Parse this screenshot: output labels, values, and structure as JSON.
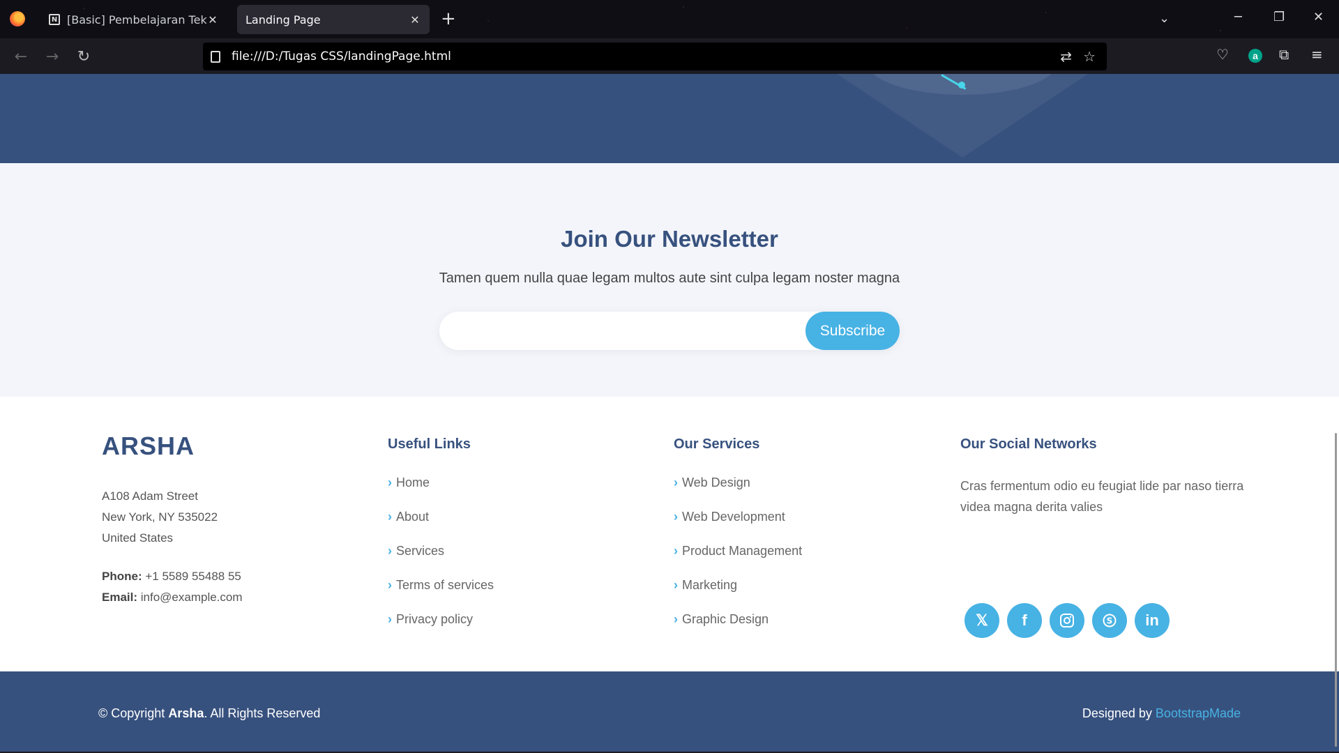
{
  "browser": {
    "tabs": [
      {
        "title": "[Basic] Pembelajaran Teknis Re",
        "favicon": "N"
      },
      {
        "title": "Landing Page"
      }
    ],
    "url": "file:///D:/Tugas CSS/landingPage.html",
    "account_initial": "a"
  },
  "newsletter": {
    "title": "Join Our Newsletter",
    "subtitle": "Tamen quem nulla quae legam multos aute sint culpa legam noster magna",
    "input_value": "",
    "button_label": "Subscribe"
  },
  "footer": {
    "brand": "ARSHA",
    "address": [
      "A108 Adam Street",
      "New York, NY 535022",
      "United States"
    ],
    "phone_label": "Phone:",
    "phone": " +1 5589 55488 55",
    "email_label": "Email:",
    "email": " info@example.com",
    "useful_links": {
      "title": "Useful Links",
      "items": [
        "Home",
        "About",
        "Services",
        "Terms of services",
        "Privacy policy"
      ]
    },
    "services": {
      "title": "Our Services",
      "items": [
        "Web Design",
        "Web Development",
        "Product Management",
        "Marketing",
        "Graphic Design"
      ]
    },
    "social": {
      "title": "Our Social Networks",
      "text": "Cras fermentum odio eu feugiat lide par naso tierra videa magna derita valies",
      "icons": [
        "x-icon",
        "facebook-icon",
        "instagram-icon",
        "skype-icon",
        "linkedin-icon"
      ]
    },
    "copyright_prefix": "© Copyright ",
    "copyright_brand": "Arsha",
    "copyright_suffix": ". All Rights Reserved",
    "credits_prefix": "Designed by ",
    "credits_link": "BootstrapMade"
  },
  "colors": {
    "primary": "#37517e",
    "accent": "#47b2e4",
    "newsletter_bg": "#f3f5fa"
  }
}
